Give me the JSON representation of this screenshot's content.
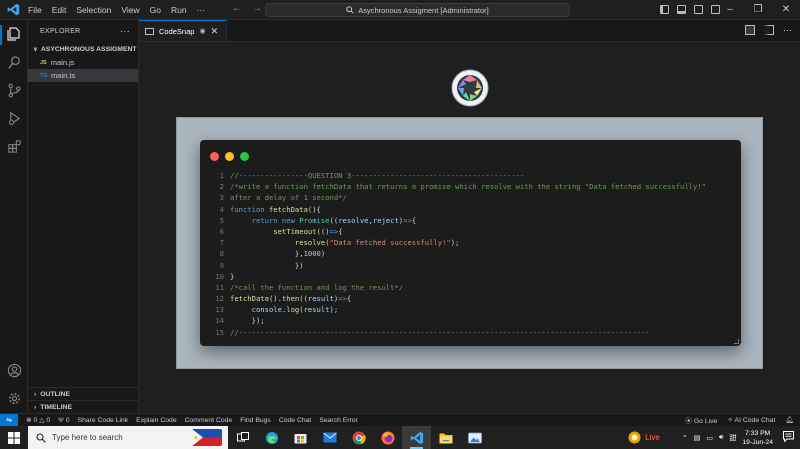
{
  "titlebar": {
    "menu": [
      "File",
      "Edit",
      "Selection",
      "View",
      "Go",
      "Run",
      "···"
    ],
    "command_center": "Asychronous Assigment [Administrator]"
  },
  "sidebar": {
    "header": "EXPLORER",
    "folder": "ASYCHRONOUS ASSIGMENT",
    "files": [
      {
        "badge": "JS",
        "name": "main.js",
        "badge_color": "#cbcb41"
      },
      {
        "badge": "TS",
        "name": "main.ts",
        "badge_color": "#3178c6"
      }
    ],
    "outline": "OUTLINE",
    "timeline": "TIMELINE"
  },
  "editor": {
    "tab_label": "CodeSnap",
    "code_lines": [
      {
        "n": "1",
        "parts": [
          {
            "c": "cm",
            "t": "//----------------QUESTION 3----------------------------------------"
          }
        ]
      },
      {
        "n": "2",
        "parts": [
          {
            "c": "cm",
            "t": "/*write a function fetchData that returns a promise which resolve with the string \"Data fetched successfully!\""
          }
        ]
      },
      {
        "n": "3",
        "parts": [
          {
            "c": "cm",
            "t": "after a delay of 1 second*/"
          }
        ]
      },
      {
        "n": "4",
        "parts": [
          {
            "c": "kw",
            "t": "function "
          },
          {
            "c": "fn",
            "t": "fetchData"
          },
          {
            "c": "pl",
            "t": "(){"
          }
        ]
      },
      {
        "n": "5",
        "parts": [
          {
            "c": "pl",
            "t": "     "
          },
          {
            "c": "kw",
            "t": "return new "
          },
          {
            "c": "cls",
            "t": "Promise"
          },
          {
            "c": "pl",
            "t": "(("
          },
          {
            "c": "pm",
            "t": "resolve"
          },
          {
            "c": "pl",
            "t": ","
          },
          {
            "c": "pm",
            "t": "reject"
          },
          {
            "c": "pl",
            "t": ")"
          },
          {
            "c": "kw",
            "t": "=>"
          },
          {
            "c": "pl",
            "t": "{"
          }
        ]
      },
      {
        "n": "6",
        "parts": [
          {
            "c": "pl",
            "t": "          "
          },
          {
            "c": "fn",
            "t": "setTimeout"
          },
          {
            "c": "pl",
            "t": "(()"
          },
          {
            "c": "kw",
            "t": "=>"
          },
          {
            "c": "pl",
            "t": "{"
          }
        ]
      },
      {
        "n": "7",
        "parts": [
          {
            "c": "pl",
            "t": "               "
          },
          {
            "c": "fn",
            "t": "resolve"
          },
          {
            "c": "pl",
            "t": "("
          },
          {
            "c": "st",
            "t": "\"Data fetched successfully!\""
          },
          {
            "c": "pl",
            "t": ");"
          }
        ]
      },
      {
        "n": "8",
        "parts": [
          {
            "c": "pl",
            "t": "               },"
          },
          {
            "c": "num",
            "t": "1000"
          },
          {
            "c": "pl",
            "t": ")"
          }
        ]
      },
      {
        "n": "9",
        "parts": [
          {
            "c": "pl",
            "t": "               })"
          }
        ]
      },
      {
        "n": "10",
        "parts": [
          {
            "c": "pl",
            "t": "}"
          }
        ]
      },
      {
        "n": "11",
        "parts": [
          {
            "c": "cm",
            "t": "/*call the function and log the result*/"
          }
        ]
      },
      {
        "n": "12",
        "parts": [
          {
            "c": "fn",
            "t": "fetchData"
          },
          {
            "c": "pl",
            "t": "()."
          },
          {
            "c": "fn",
            "t": "then"
          },
          {
            "c": "pl",
            "t": "(("
          },
          {
            "c": "pm",
            "t": "result"
          },
          {
            "c": "pl",
            "t": ")"
          },
          {
            "c": "kw",
            "t": "=>"
          },
          {
            "c": "pl",
            "t": "{"
          }
        ]
      },
      {
        "n": "13",
        "parts": [
          {
            "c": "pl",
            "t": "     "
          },
          {
            "c": "pm",
            "t": "console"
          },
          {
            "c": "pl",
            "t": "."
          },
          {
            "c": "fn",
            "t": "log"
          },
          {
            "c": "pl",
            "t": "("
          },
          {
            "c": "pm",
            "t": "result"
          },
          {
            "c": "pl",
            "t": ");"
          }
        ]
      },
      {
        "n": "14",
        "parts": [
          {
            "c": "pl",
            "t": "     });"
          }
        ]
      },
      {
        "n": "15",
        "parts": [
          {
            "c": "cm",
            "t": "//-----------------------------------------------------------------------------------------------"
          }
        ]
      }
    ]
  },
  "statusbar": {
    "errors": "0",
    "warnings": "0",
    "ports": "0",
    "items": [
      "Share Code Link",
      "Explain Code",
      "Comment Code",
      "Find Bugs",
      "Code Chat",
      "Search Error"
    ],
    "go_live": "Go Live",
    "ai_chat": "AI Code Chat"
  },
  "taskbar": {
    "search_placeholder": "Type here to search",
    "live_label": "Live",
    "time": "7:33 PM",
    "date": "19-Jun-24"
  },
  "colors": {
    "accent": "#0078d4",
    "dot_red": "#ff5f57",
    "dot_yellow": "#febc2e",
    "dot_green": "#28c840"
  }
}
